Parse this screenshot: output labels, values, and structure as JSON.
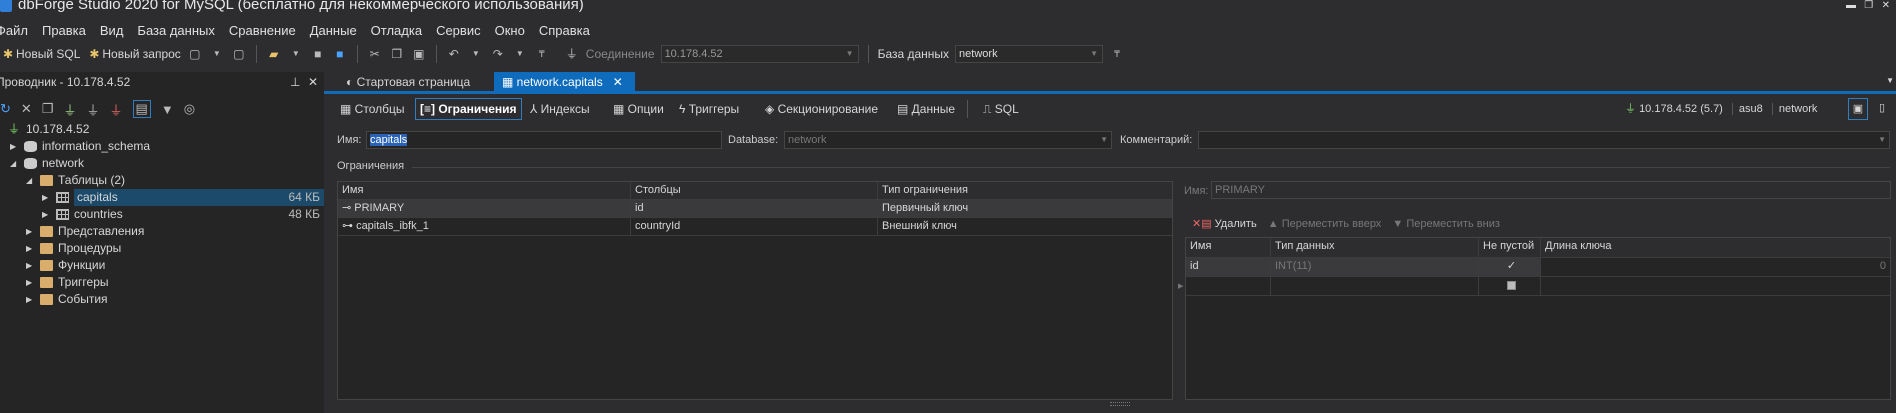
{
  "window": {
    "title": "dbForge Studio 2020 for MySQL (бесплатно для некоммерческого использования)",
    "min": "▬",
    "restore": "❐",
    "close": "✕"
  },
  "menu": [
    "Файл",
    "Правка",
    "Вид",
    "База данных",
    "Сравнение",
    "Данные",
    "Отладка",
    "Сервис",
    "Окно",
    "Справка"
  ],
  "toolbar": {
    "new_sql": "Новый SQL",
    "new_query": "Новый запрос",
    "connection_label": "Соединение",
    "connection_value": "10.178.4.52",
    "database_label": "База данных",
    "database_value": "network"
  },
  "explorer": {
    "title": "Проводник - 10.178.4.52",
    "tree": [
      {
        "label": "10.178.4.52",
        "icon": "plug-icon",
        "level": 0,
        "expander": ""
      },
      {
        "label": "information_schema",
        "icon": "database-icon",
        "level": 1,
        "expander": "▶"
      },
      {
        "label": "network",
        "icon": "database-icon",
        "level": 1,
        "expander": "◢"
      },
      {
        "label": "Таблицы (2)",
        "icon": "folder-open-icon",
        "level": 2,
        "expander": "◢"
      },
      {
        "label": "capitals",
        "icon": "table-icon",
        "level": 3,
        "expander": "▶",
        "size": "64 КБ",
        "selected": true
      },
      {
        "label": "countries",
        "icon": "table-icon",
        "level": 3,
        "expander": "▶",
        "size": "48 КБ"
      },
      {
        "label": "Представления",
        "icon": "folder-icon",
        "level": 2,
        "expander": "▶"
      },
      {
        "label": "Процедуры",
        "icon": "folder-icon",
        "level": 2,
        "expander": "▶"
      },
      {
        "label": "Функции",
        "icon": "folder-icon",
        "level": 2,
        "expander": "▶"
      },
      {
        "label": "Триггеры",
        "icon": "folder-icon",
        "level": 2,
        "expander": "▶"
      },
      {
        "label": "События",
        "icon": "folder-icon",
        "level": 2,
        "expander": "▶"
      }
    ]
  },
  "doc_tabs": {
    "start": "Стартовая страница",
    "active": "network.capitals",
    "close": "✕"
  },
  "subtabs": [
    "Столбцы",
    "Ограничения",
    "Индексы",
    "Опции",
    "Триггеры",
    "Секционирование",
    "Данные",
    "SQL"
  ],
  "status": {
    "server": "10.178.4.52 (5.7)",
    "user": "asu8",
    "database": "network"
  },
  "form": {
    "name_label": "Имя:",
    "name_value": "capitals",
    "database_label": "Database:",
    "database_value": "network",
    "comment_label": "Комментарий:",
    "comment_value": ""
  },
  "constraints": {
    "section": "Ограничения",
    "headers": [
      "Имя",
      "Столбцы",
      "Тип ограничения"
    ],
    "rows": [
      {
        "name": "PRIMARY",
        "columns": "id",
        "type": "Первичный ключ"
      },
      {
        "name": "capitals_ibfk_1",
        "columns": "countryId",
        "type": "Внешний ключ"
      }
    ]
  },
  "detail": {
    "name_label": "Имя:",
    "name_value": "PRIMARY",
    "delete": "Удалить",
    "move_up": "Переместить вверх",
    "move_down": "Переместить вниз",
    "headers": [
      "Имя",
      "Тип данных",
      "Не пустой",
      "Длина ключа"
    ],
    "rows": [
      {
        "name": "id",
        "type": "INT(11)",
        "not_null": "✓",
        "key_length": "0"
      }
    ]
  }
}
